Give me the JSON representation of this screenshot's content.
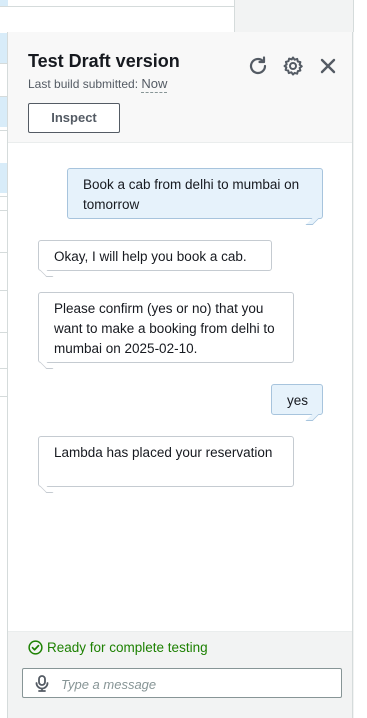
{
  "panel": {
    "title": "Test Draft version",
    "build_label": "Last build submitted:",
    "build_value": "Now",
    "inspect_label": "Inspect",
    "icons": [
      "refresh-icon",
      "gear-icon",
      "close-icon"
    ]
  },
  "messages": [
    {
      "sender": "user",
      "text": "Book a cab from delhi to mumbai on tomorrow"
    },
    {
      "sender": "bot",
      "text": "Okay, I will help you book a cab."
    },
    {
      "sender": "bot",
      "text": "Please confirm (yes or no) that you want to make a booking from delhi to mumbai on 2025-02-10."
    },
    {
      "sender": "user",
      "text": "yes"
    },
    {
      "sender": "bot",
      "text": "Lambda has placed your reservation"
    }
  ],
  "footer": {
    "status": "Ready for complete testing",
    "input_placeholder": "Type a message",
    "input_value": ""
  },
  "colors": {
    "user_bubble": "#e6f2fb",
    "bot_bubble": "#ffffff",
    "status_green": "#1d8102"
  }
}
